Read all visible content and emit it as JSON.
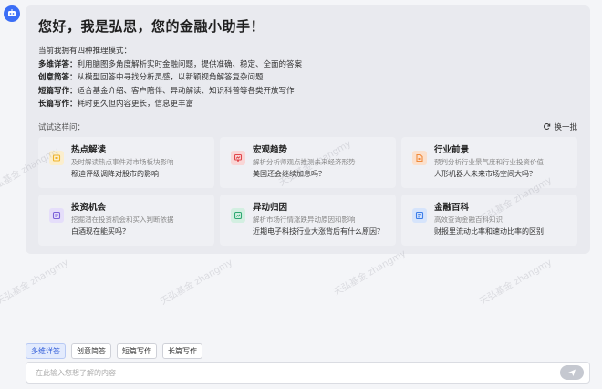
{
  "assistant": {
    "greeting": "您好，我是弘思，您的金融小助手！",
    "intro": "当前我拥有四种推理模式：",
    "modes": [
      {
        "name": "多维详答：",
        "desc": "利用脑图多角度解析实时金融问题，提供准确、稳定、全面的答案"
      },
      {
        "name": "创意简答：",
        "desc": "从模型回答中寻找分析灵感，以新颖视角解答复杂问题"
      },
      {
        "name": "短篇写作：",
        "desc": "适合基金介绍、客户陪伴、异动解读、知识科普等各类开放写作"
      },
      {
        "name": "长篇写作：",
        "desc": "耗时更久但内容更长，信息更丰富"
      }
    ]
  },
  "suggestions": {
    "label": "试试这样问：",
    "refresh_label": "换一批",
    "items": [
      {
        "title": "热点解读",
        "desc": "及时解读热点事件对市场板块影响",
        "question": "穆迪评级调降对股市的影响",
        "icon": "hotspot-icon",
        "color": "#f0b429",
        "bg": "#fbeecd"
      },
      {
        "title": "宏观趋势",
        "desc": "解析分析师观点推测未来经济形势",
        "question": "美国还会继续加息吗？",
        "icon": "trend-icon",
        "color": "#e0464a",
        "bg": "#f9d6d6"
      },
      {
        "title": "行业前景",
        "desc": "预判分析行业景气度和行业投资价值",
        "question": "人形机器人未来市场空间大吗？",
        "icon": "industry-icon",
        "color": "#f08a3c",
        "bg": "#fbe0cc"
      },
      {
        "title": "投资机会",
        "desc": "挖掘潜在投资机会和买入判断依据",
        "question": "白酒现在能买吗？",
        "icon": "opportunity-icon",
        "color": "#7b61d9",
        "bg": "#e5defa"
      },
      {
        "title": "异动归因",
        "desc": "解析市场行情涨跌异动原因和影响",
        "question": "近期电子科技行业大涨背后有什么原因？",
        "icon": "attribution-icon",
        "color": "#2fa772",
        "bg": "#d3efe1"
      },
      {
        "title": "金融百科",
        "desc": "高效查询金融百科知识",
        "question": "财报里流动比率和速动比率的区别",
        "icon": "encyclopedia-icon",
        "color": "#3b7de8",
        "bg": "#d6e4fb"
      }
    ]
  },
  "watermark": "天弘基金 zhangmy",
  "mode_chips": [
    {
      "label": "多维详答",
      "active": true
    },
    {
      "label": "创意简答",
      "active": false
    },
    {
      "label": "短篇写作",
      "active": false
    },
    {
      "label": "长篇写作",
      "active": false
    }
  ],
  "input": {
    "placeholder": "在此输入您想了解的内容",
    "value": ""
  },
  "colors": {
    "accent": "#3b6ef6",
    "card_bg": "#e9eaef",
    "page_bg": "#f4f5f8"
  }
}
